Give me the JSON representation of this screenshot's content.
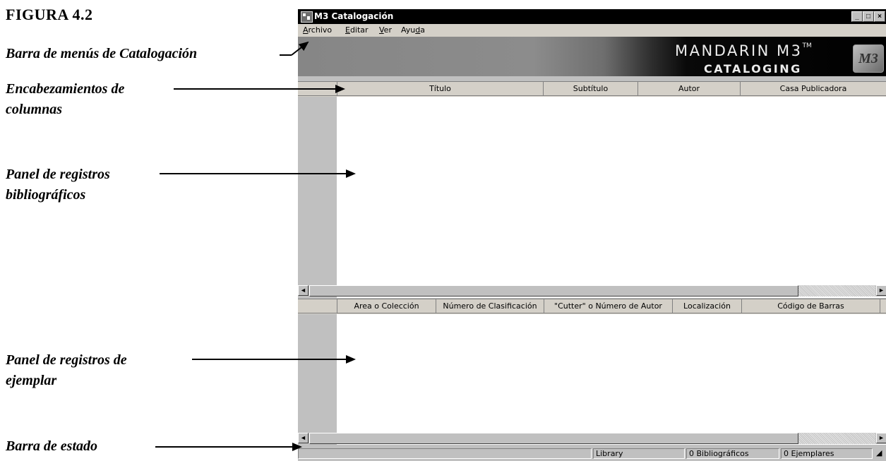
{
  "figure_title": "FIGURA 4.2",
  "callouts": {
    "menubar": "Barra de menús de Catalogación",
    "headers_1": "Encabezamientos de",
    "headers_2": "columnas",
    "biblio_1": "Panel de registros",
    "biblio_2": "bibliográficos",
    "copy_1": "Panel de registros de",
    "copy_2": "ejemplar",
    "statusbar": "Barra de estado"
  },
  "window": {
    "title": "M3 Catalogación",
    "buttons": {
      "minimize": "_",
      "maximize": "□",
      "close": "×"
    }
  },
  "menu": {
    "archivo": "Archivo",
    "editar": "Editar",
    "ver": "Ver",
    "ayuda": "Ayuda"
  },
  "banner": {
    "line1": "MANDARIN M3",
    "tm": "TM",
    "line2": "CATALOGING",
    "logo": "M3"
  },
  "bib_columns": [
    "Título",
    "Subtítulo",
    "Autor",
    "Casa Publicadora"
  ],
  "copy_columns": [
    "Area o Colección",
    "Número de Clasificación",
    "\"Cutter\" o Número de Autor",
    "Localización",
    "Código de Barras"
  ],
  "status": {
    "library": "Library",
    "biblio_count": "0 Bibliográficos",
    "copies_count": "0 Ejemplares"
  },
  "scroll_arrows": {
    "left": "◄",
    "right": "►"
  }
}
